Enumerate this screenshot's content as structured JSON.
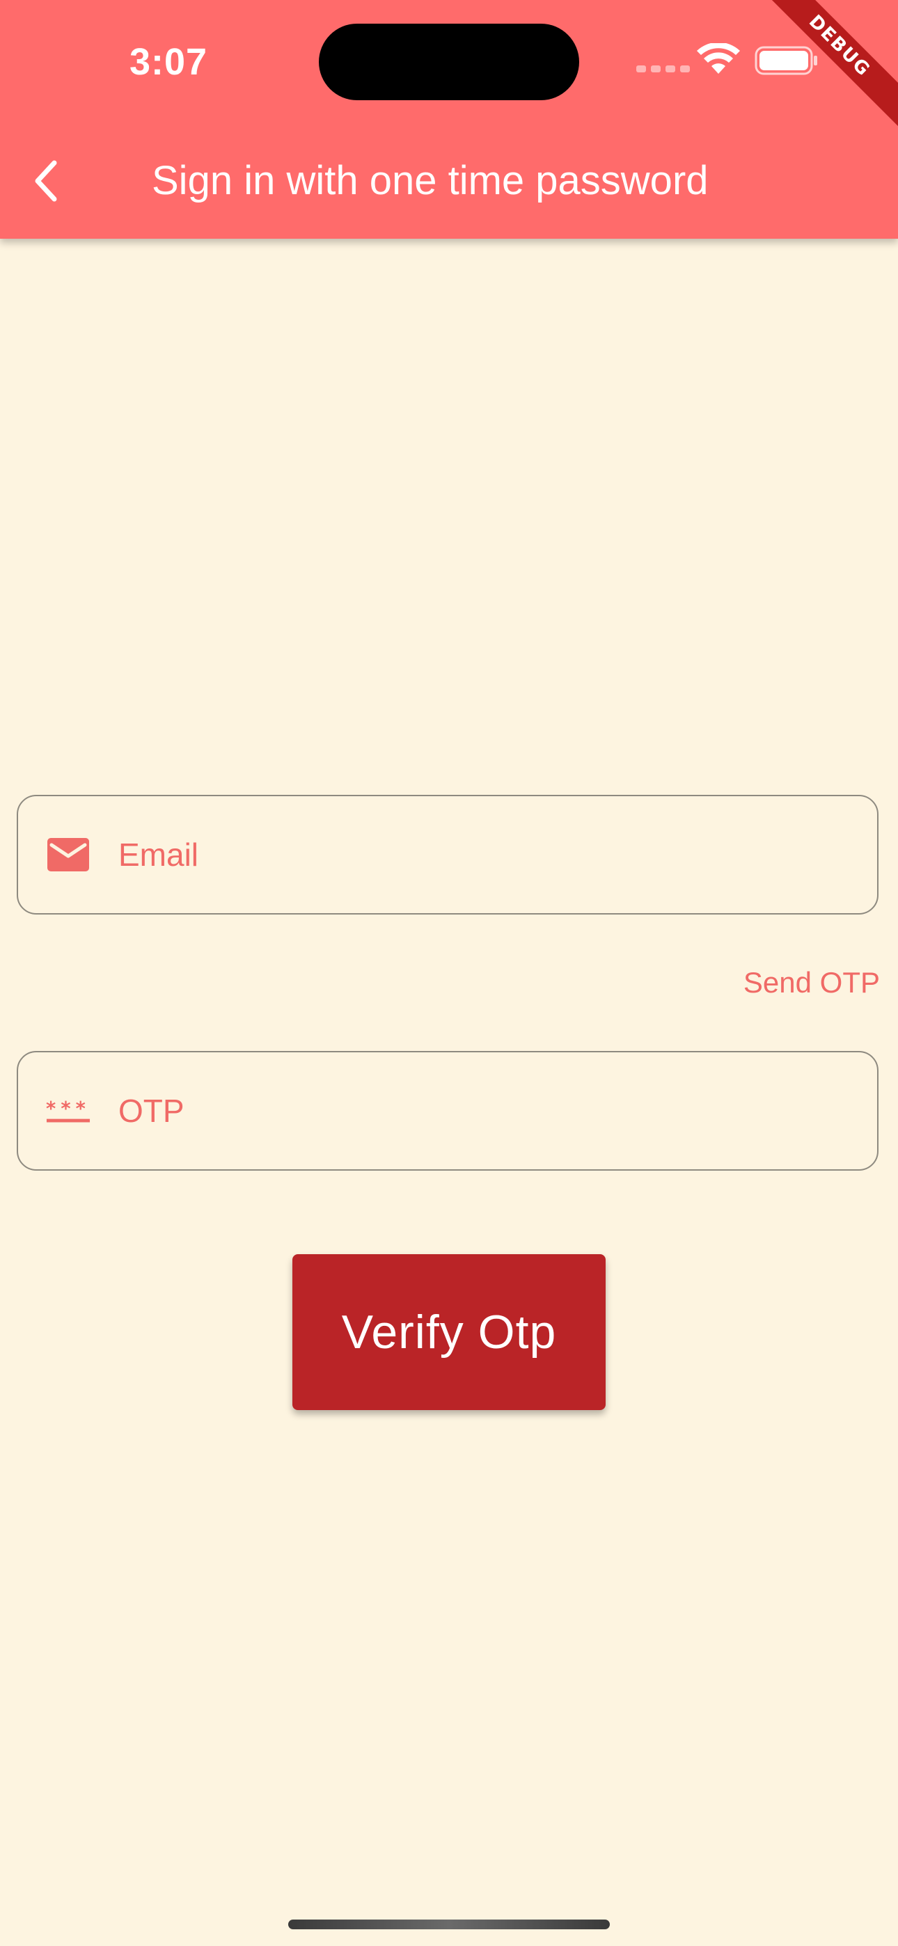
{
  "status_bar": {
    "time": "3:07",
    "icons": [
      "cellular-signal-icon",
      "wifi-icon",
      "battery-icon"
    ]
  },
  "debug_banner": "DEBUG",
  "app_bar": {
    "back_icon": "chevron-left-icon",
    "title": "Sign in with one time password"
  },
  "form": {
    "email": {
      "icon": "mail-icon",
      "label": "Email"
    },
    "send_otp_label": "Send OTP",
    "otp": {
      "icon": "password-dots-icon",
      "label": "OTP"
    },
    "verify_button_label": "Verify Otp"
  },
  "colors": {
    "app_bar": "#FF6B6B",
    "background": "#FDF4E0",
    "accent_text": "#F06A66",
    "button": "#BA2427",
    "field_border": "#8E8A80"
  }
}
